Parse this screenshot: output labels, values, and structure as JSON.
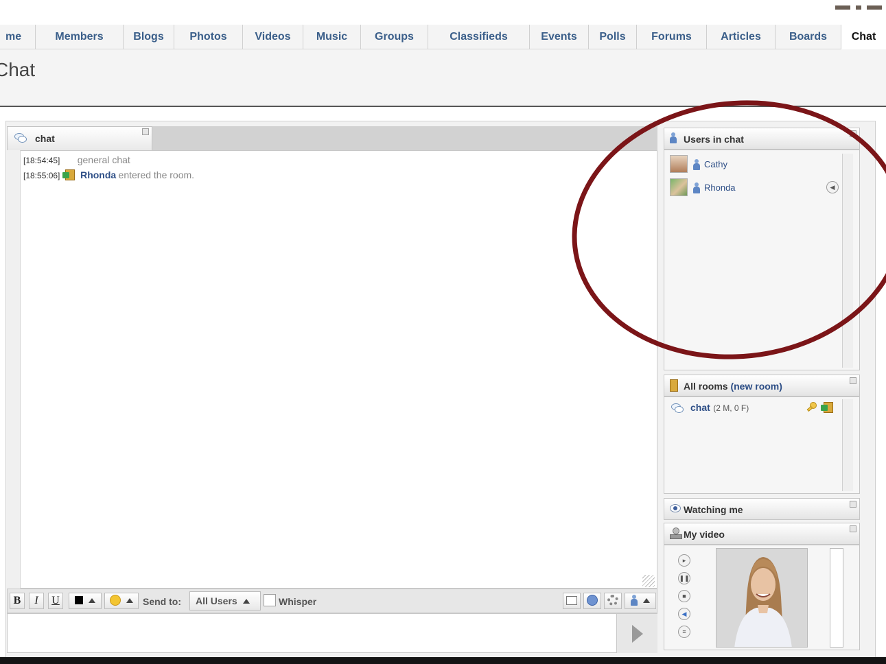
{
  "nav": {
    "tabs": [
      {
        "label": "me"
      },
      {
        "label": "Members"
      },
      {
        "label": "Blogs"
      },
      {
        "label": "Photos"
      },
      {
        "label": "Videos"
      },
      {
        "label": "Music"
      },
      {
        "label": "Groups"
      },
      {
        "label": "Classifieds"
      },
      {
        "label": "Events"
      },
      {
        "label": "Polls"
      },
      {
        "label": "Forums"
      },
      {
        "label": "Articles"
      },
      {
        "label": "Boards"
      },
      {
        "label": "Chat",
        "active": true
      }
    ]
  },
  "page": {
    "title": "Chat"
  },
  "chat": {
    "tab_label": "chat",
    "messages": [
      {
        "time": "[18:54:45]",
        "text": "general chat"
      },
      {
        "time": "[18:55:06]",
        "user": "Rhonda",
        "text": "entered the room."
      }
    ]
  },
  "toolbar": {
    "bold": "B",
    "italic": "I",
    "underline": "U",
    "send_to_label": "Send to:",
    "send_to_value": "All Users",
    "whisper_label": "Whisper"
  },
  "panels": {
    "users": {
      "title": "Users in chat",
      "list": [
        {
          "name": "Cathy"
        },
        {
          "name": "Rhonda"
        }
      ]
    },
    "rooms": {
      "title": "All rooms",
      "new_room": "(new room)",
      "list": [
        {
          "name": "chat",
          "count": "(2 M, 0 F)"
        }
      ]
    },
    "watching": {
      "title": "Watching me"
    },
    "video": {
      "title": "My video"
    }
  },
  "colors": {
    "nav_link": "#3b5f8a",
    "username": "#2d4e86",
    "annotation": "#7b1518"
  }
}
